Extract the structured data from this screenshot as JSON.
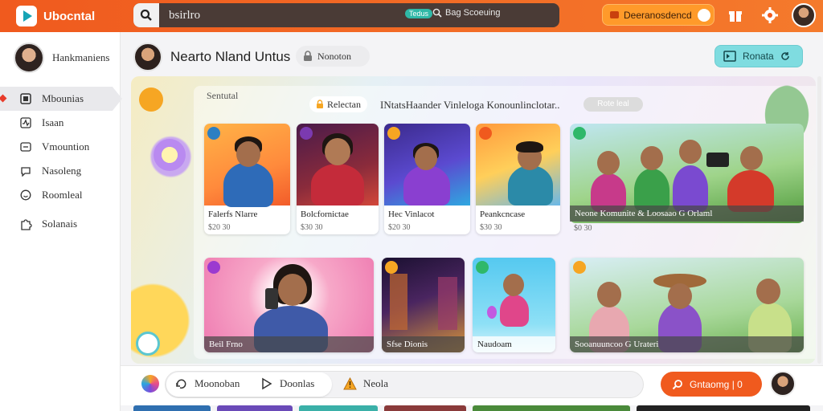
{
  "topbar": {
    "logo_text": "Ubocntal",
    "search_value": "",
    "search_placeholder": "bsirlro",
    "search_pill": "Tedus",
    "search_trend": "Bag Scoeuing",
    "cta_label": "Deeranosdencd",
    "accent": "#f05a1e",
    "icons": [
      "search-icon",
      "gift-icon",
      "gear-icon",
      "avatar"
    ]
  },
  "sidebar": {
    "profile_name": "Hankmaniens",
    "items": [
      {
        "label": "Mbounias",
        "icon": "library-icon",
        "active": true
      },
      {
        "label": "Isaan",
        "icon": "activity-icon",
        "active": false
      },
      {
        "label": "Vmountion",
        "icon": "screen-icon",
        "active": false
      },
      {
        "label": "Nasoleng",
        "icon": "chat-icon",
        "active": false
      },
      {
        "label": "Roomleal",
        "icon": "smile-icon",
        "active": false
      },
      {
        "label": "Solanais",
        "icon": "puzzle-icon",
        "active": false
      }
    ]
  },
  "header": {
    "channel_title": "Nearto Nland Untus",
    "lock_label": "Nonoton",
    "resume_label": "Ronata"
  },
  "canvas": {
    "section_label": "Sentutal",
    "filter_label": "Relectan",
    "headline": "INtatsHaander Vinleloga Konounlinclotar..",
    "chip_label": "Rote leal"
  },
  "tiles": [
    {
      "title": "Falerfs Nlarre",
      "meta": "$20 30"
    },
    {
      "title": "Bolcfornictae",
      "meta": "$30 30"
    },
    {
      "title": "Hec Vinlacot",
      "meta": "$20 30"
    },
    {
      "title": "Peankcncase",
      "meta": "$30 30"
    },
    {
      "title": "Neone Komunite & Loosaao G Orlaml",
      "meta": "$0 30"
    },
    {
      "title": "Beil Frno",
      "meta": ""
    },
    {
      "title": "Sfse Dionis",
      "meta": ""
    },
    {
      "title": "Naudoam",
      "meta": ""
    },
    {
      "title": "Sooanuuncoo G Urateri",
      "meta": ""
    }
  ],
  "bottombar": {
    "tabs": [
      {
        "label": "Moonoban",
        "icon": "swap-icon"
      },
      {
        "label": "Doonlas",
        "icon": "play-icon"
      },
      {
        "label": "Neola",
        "icon": "warning-icon"
      }
    ],
    "cta_label": "Gntaomg | 0"
  }
}
